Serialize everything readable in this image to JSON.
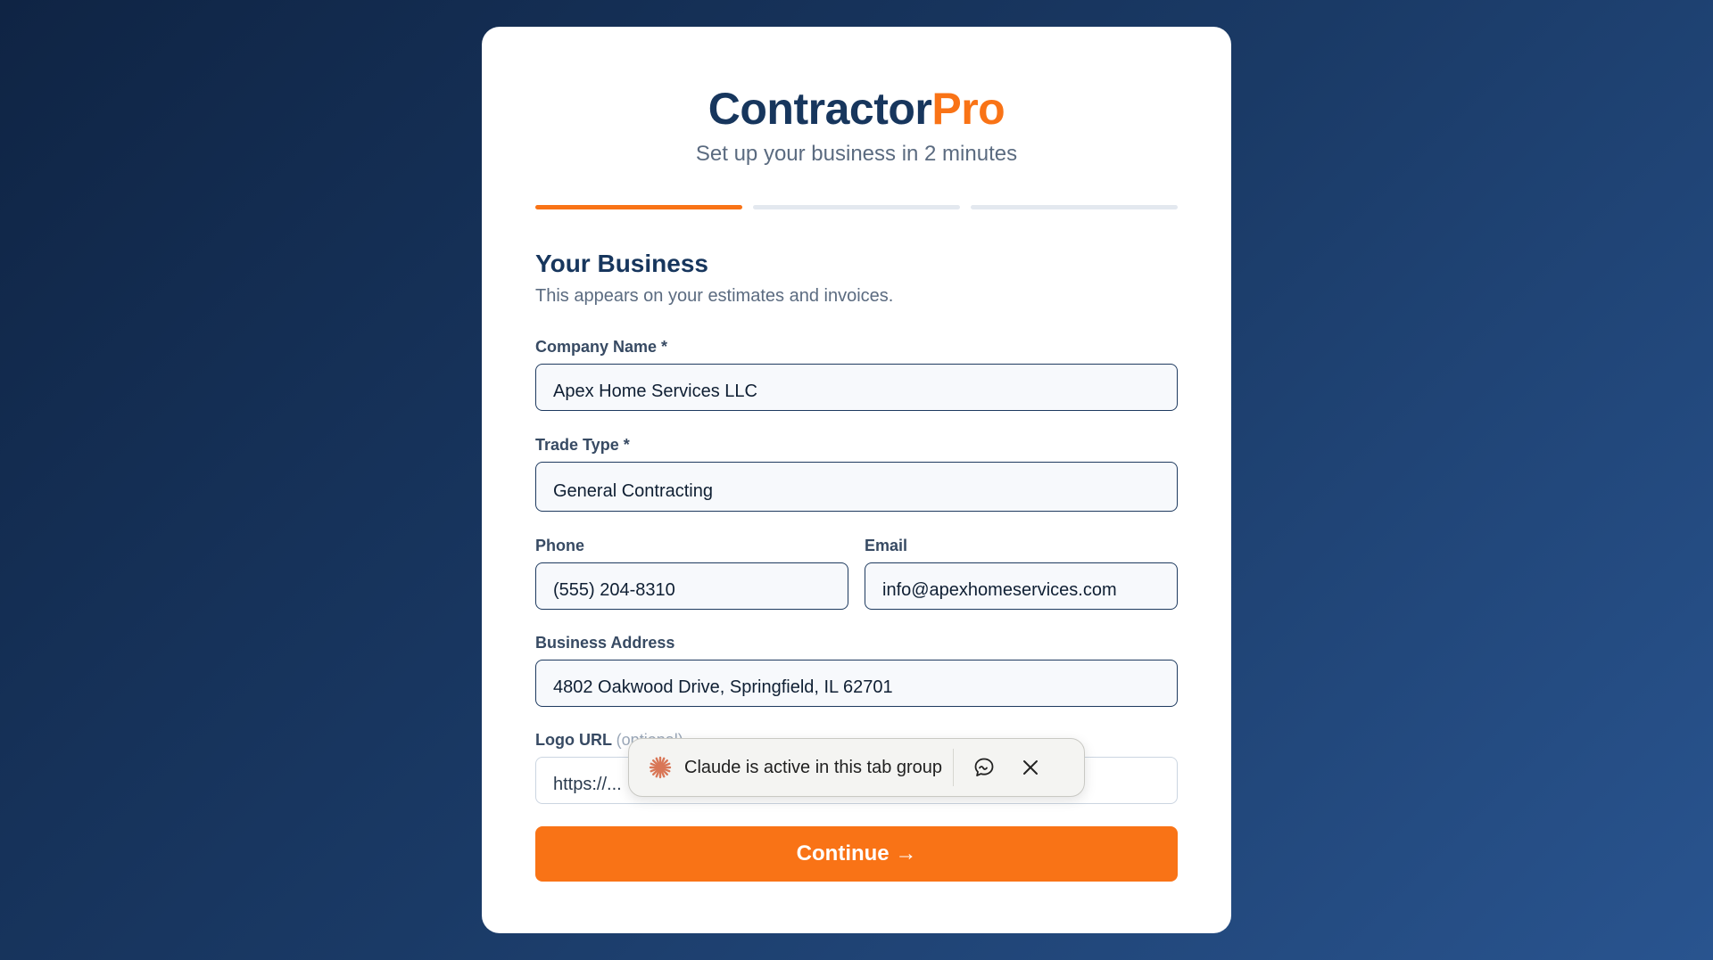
{
  "brand": {
    "name_part1": "Contractor",
    "name_part2": "Pro"
  },
  "tagline": "Set up your business in 2 minutes",
  "progress": {
    "total_steps": 3,
    "current_step": 1
  },
  "section": {
    "title": "Your Business",
    "subtitle": "This appears on your estimates and invoices."
  },
  "fields": {
    "company_name": {
      "label": "Company Name *",
      "value": "Apex Home Services LLC"
    },
    "trade_type": {
      "label": "Trade Type *",
      "value": "General Contracting"
    },
    "phone": {
      "label": "Phone",
      "value": "(555) 204-8310"
    },
    "email": {
      "label": "Email",
      "value": "info@apexhomeservices.com"
    },
    "address": {
      "label": "Business Address",
      "value": "4802 Oakwood Drive, Springfield, IL 62701"
    },
    "logo_url": {
      "label": "Logo URL",
      "optional": "(optional)",
      "placeholder": "https://..."
    }
  },
  "continue_button": {
    "label": "Continue →"
  },
  "toast": {
    "text": "Claude is active in this tab group",
    "icons": {
      "logo": "claude-spark-icon",
      "chat": "chat-bubble-icon",
      "close": "close-icon"
    }
  },
  "colors": {
    "accent": "#f97316",
    "brand_dark": "#17365d",
    "claude_orange": "#d97757"
  }
}
